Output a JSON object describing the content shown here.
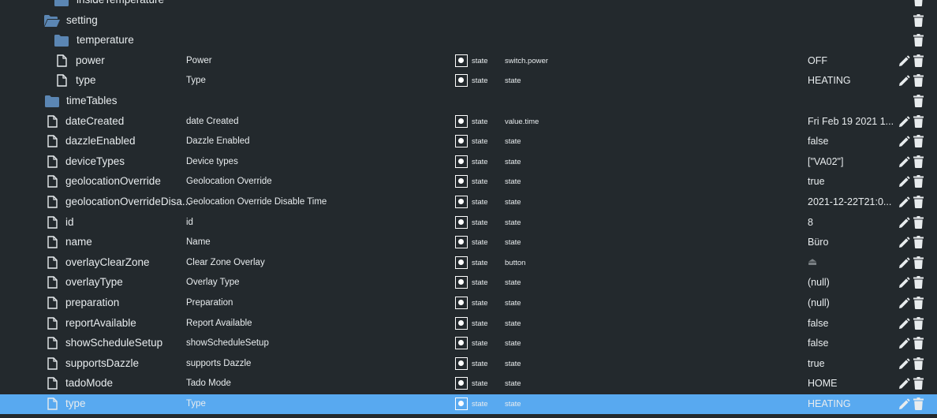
{
  "colors": {
    "background": "#23292d",
    "selected_row": "#58a9f0",
    "folder": "#5b86b3",
    "text": "#e8ecee",
    "muted": "#7a8084"
  },
  "rows": [
    {
      "kind": "folder",
      "name": "insideTemperature",
      "level": 2
    },
    {
      "kind": "folder-open",
      "name": "setting",
      "level": 1
    },
    {
      "kind": "folder",
      "name": "temperature",
      "level": 2
    },
    {
      "kind": "state",
      "name": "power",
      "level": 2,
      "title": "Power",
      "type": "state",
      "role": "switch.power",
      "value": "OFF"
    },
    {
      "kind": "state",
      "name": "type",
      "level": 2,
      "title": "Type",
      "type": "state",
      "role": "state",
      "value": "HEATING"
    },
    {
      "kind": "folder",
      "name": "timeTables",
      "level": 1
    },
    {
      "kind": "state",
      "name": "dateCreated",
      "level": 1,
      "title": "date Created",
      "type": "state",
      "role": "value.time",
      "value": "Fri Feb 19 2021 1..."
    },
    {
      "kind": "state",
      "name": "dazzleEnabled",
      "level": 1,
      "title": "Dazzle Enabled",
      "type": "state",
      "role": "state",
      "value": "false"
    },
    {
      "kind": "state",
      "name": "deviceTypes",
      "level": 1,
      "title": "Device types",
      "type": "state",
      "role": "state",
      "value": "[\"VA02\"]"
    },
    {
      "kind": "state",
      "name": "geolocationOverride",
      "level": 1,
      "title": "Geolocation Override",
      "type": "state",
      "role": "state",
      "value": "true"
    },
    {
      "kind": "state",
      "name": "geolocationOverrideDisa...",
      "level": 1,
      "title": "Geolocation Override Disable Time",
      "type": "state",
      "role": "state",
      "value": "2021-12-22T21:0..."
    },
    {
      "kind": "state",
      "name": "id",
      "level": 1,
      "title": "id",
      "type": "state",
      "role": "state",
      "value": "8"
    },
    {
      "kind": "state",
      "name": "name",
      "level": 1,
      "title": "Name",
      "type": "state",
      "role": "state",
      "value": "Büro"
    },
    {
      "kind": "state",
      "name": "overlayClearZone",
      "level": 1,
      "title": "Clear Zone Overlay",
      "type": "state",
      "role": "button",
      "value": "⏏",
      "button": true
    },
    {
      "kind": "state",
      "name": "overlayType",
      "level": 1,
      "title": "Overlay Type",
      "type": "state",
      "role": "state",
      "value": "(null)"
    },
    {
      "kind": "state",
      "name": "preparation",
      "level": 1,
      "title": "Preparation",
      "type": "state",
      "role": "state",
      "value": "(null)"
    },
    {
      "kind": "state",
      "name": "reportAvailable",
      "level": 1,
      "title": "Report Available",
      "type": "state",
      "role": "state",
      "value": "false"
    },
    {
      "kind": "state",
      "name": "showScheduleSetup",
      "level": 1,
      "title": "showScheduleSetup",
      "type": "state",
      "role": "state",
      "value": "false"
    },
    {
      "kind": "state",
      "name": "supportsDazzle",
      "level": 1,
      "title": "supports Dazzle",
      "type": "state",
      "role": "state",
      "value": "true"
    },
    {
      "kind": "state",
      "name": "tadoMode",
      "level": 1,
      "title": "Tado Mode",
      "type": "state",
      "role": "state",
      "value": "HOME"
    },
    {
      "kind": "state",
      "name": "type",
      "level": 1,
      "title": "Type",
      "type": "state",
      "role": "state",
      "value": "HEATING",
      "selected": true
    }
  ]
}
